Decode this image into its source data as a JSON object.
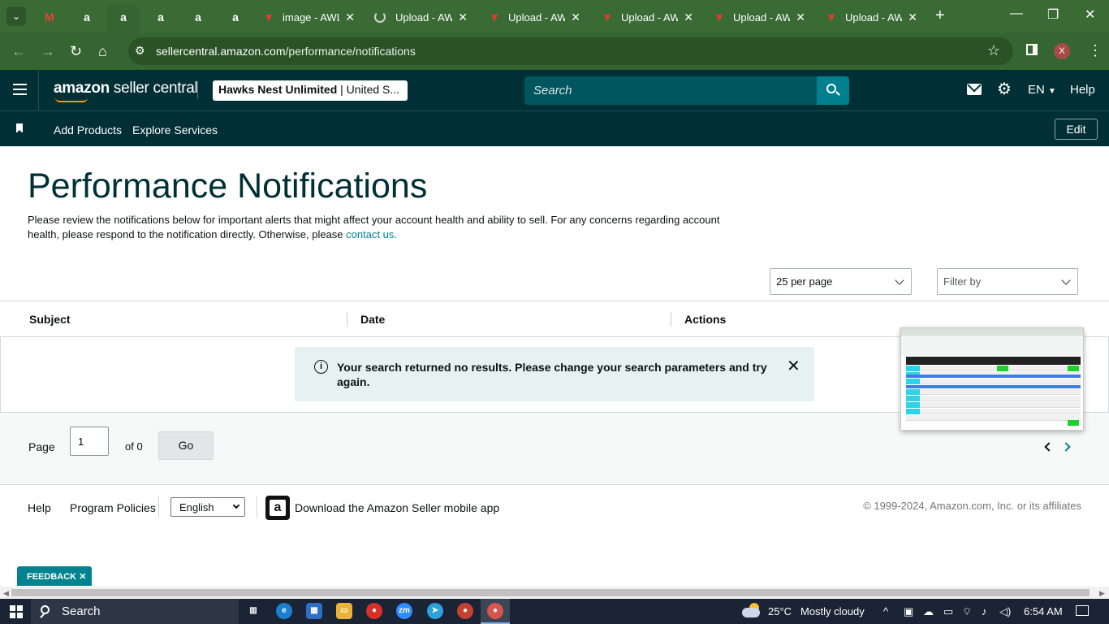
{
  "browser": {
    "tabs": [
      {
        "kind": "gmail",
        "title": ""
      },
      {
        "kind": "amazon",
        "title": ""
      },
      {
        "kind": "amazon",
        "title": "",
        "active": true
      },
      {
        "kind": "amazon",
        "title": ""
      },
      {
        "kind": "amazon",
        "title": ""
      },
      {
        "kind": "amazon",
        "title": ""
      },
      {
        "kind": "aw",
        "title": "image - AWL"
      },
      {
        "kind": "loading",
        "title": "Upload - AW"
      },
      {
        "kind": "aw",
        "title": "Upload - AW"
      },
      {
        "kind": "aw",
        "title": "Upload - AW"
      },
      {
        "kind": "aw",
        "title": "Upload - AW"
      },
      {
        "kind": "aw",
        "title": "Upload - AW"
      }
    ],
    "url_host": "sellercentral.amazon.com",
    "url_path": "/performance/notifications",
    "profile_initial": "X"
  },
  "header": {
    "logo_bold": "amazon",
    "logo_rest": " seller central",
    "account_name": "Hawks Nest Unlimited",
    "account_region": " | United S...",
    "search_placeholder": "Search",
    "language": "EN",
    "help": "Help"
  },
  "subnav": {
    "links": [
      "Add Products",
      "Explore Services"
    ],
    "edit": "Edit"
  },
  "main": {
    "title": "Performance Notifications",
    "intro_text": "Please review the notifications below for important alerts that might affect your account health and ability to sell. For any concerns regarding account health, please respond to the notification directly. Otherwise, please ",
    "intro_link": "contact us.",
    "per_page": "25 per page",
    "filter_placeholder": "Filter by",
    "columns": [
      "Subject",
      "Date",
      "Actions"
    ],
    "empty_message": "Your search returned no results. Please change your search parameters and try again.",
    "pager": {
      "label": "Page",
      "value": "1",
      "of": "of 0",
      "go": "Go"
    }
  },
  "footer": {
    "help": "Help",
    "program_policies": "Program Policies",
    "language": "English",
    "app_text": "Download the Amazon Seller mobile app",
    "copyright": "© 1999-2024, Amazon.com, Inc. or its affiliates"
  },
  "feedback": "FEEDBACK",
  "taskbar": {
    "search": "Search",
    "temperature": "25°C",
    "weather": "Mostly cloudy",
    "time": "6:54 AM"
  },
  "colors": {
    "chrome_frame": "#3a6b35",
    "sc_header": "#002f36",
    "search_button": "#00808c",
    "link": "#008296",
    "alert_bg": "#e6f2f2"
  }
}
